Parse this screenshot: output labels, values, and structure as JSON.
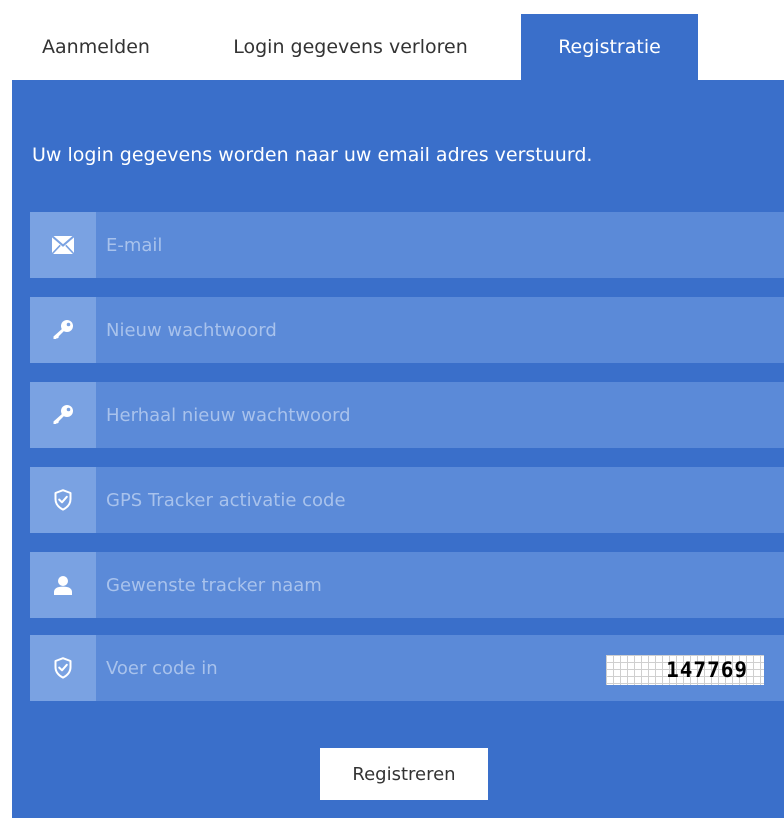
{
  "colors": {
    "accent": "#3a6fca",
    "field": "#5b8ad8",
    "icon_box": "#7aa2e2",
    "placeholder": "#a8c2ec"
  },
  "tabs": [
    {
      "label": "Aanmelden",
      "active": false
    },
    {
      "label": "Login gegevens verloren",
      "active": false
    },
    {
      "label": "Registratie",
      "active": true
    }
  ],
  "form": {
    "intro": "Uw login gegevens worden naar uw email adres verstuurd.",
    "fields": [
      {
        "placeholder": "E-mail",
        "value": "",
        "icon": "envelope-icon"
      },
      {
        "placeholder": "Nieuw wachtwoord",
        "value": "",
        "icon": "key-icon"
      },
      {
        "placeholder": "Herhaal nieuw wachtwoord",
        "value": "",
        "icon": "key-icon"
      },
      {
        "placeholder": "GPS Tracker activatie code",
        "value": "",
        "icon": "shield-check-icon"
      },
      {
        "placeholder": "Gewenste tracker naam",
        "value": "",
        "icon": "user-icon"
      },
      {
        "placeholder": "Voer code in",
        "value": "",
        "icon": "shield-check-icon"
      }
    ],
    "captcha_code": "147769",
    "submit_label": "Registreren"
  }
}
